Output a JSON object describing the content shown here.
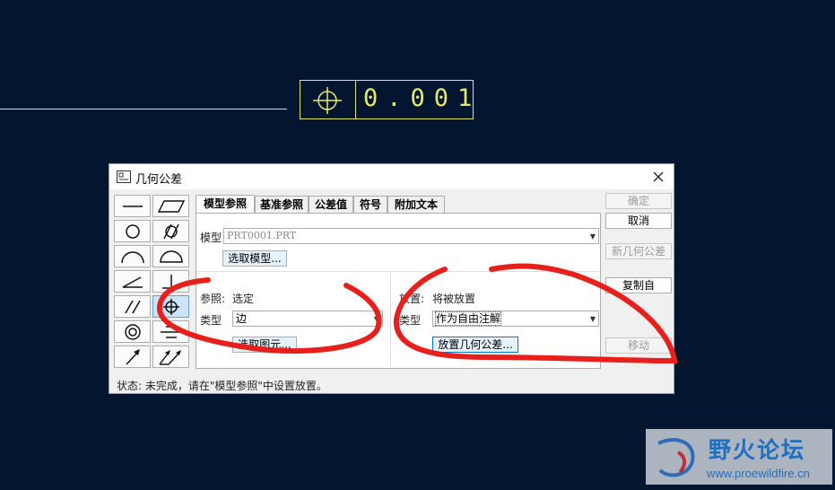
{
  "drawing": {
    "tolerance_value": "0.001",
    "tolerance_symbol": "position-icon"
  },
  "dialog": {
    "title": "几何公差",
    "tabs": [
      "模型参照",
      "基准参照",
      "公差值",
      "符号",
      "附加文本"
    ],
    "model_label": "模型",
    "model_value": "PRT0001.PRT",
    "select_model_btn": "选取模型...",
    "reference_label": "参照:",
    "reference_value": "选定",
    "ref_type_label": "类型",
    "ref_type_value": "边",
    "select_entity_btn": "选取图元...",
    "placement_label": "放置:",
    "placement_value": "将被放置",
    "place_type_label": "类型",
    "place_type_value": "作为自由注解",
    "place_btn": "放置几何公差...",
    "side_buttons": {
      "ok": "确定",
      "cancel": "取消",
      "new": "新几何公差",
      "copy": "复制自",
      "move": "移动"
    },
    "status": "状态: 未完成，请在\"模型参照\"中设置放置。"
  },
  "palette_icons": [
    "straightness-icon",
    "flatness-icon",
    "circularity-icon",
    "cylindricity-icon",
    "line-profile-icon",
    "surface-profile-icon",
    "angularity-icon",
    "perpendicularity-icon",
    "parallelism-icon",
    "position-icon",
    "concentricity-icon",
    "symmetry-icon",
    "circular-runout-icon",
    "total-runout-icon"
  ],
  "watermark": {
    "title": "野火论坛",
    "url": "www.proewildfire.cn"
  },
  "colors": {
    "background": "#04162f",
    "drawing_yellow": "#e8e86a",
    "annotation_red": "#e8201c",
    "selected_blue": "#cce4f7"
  }
}
